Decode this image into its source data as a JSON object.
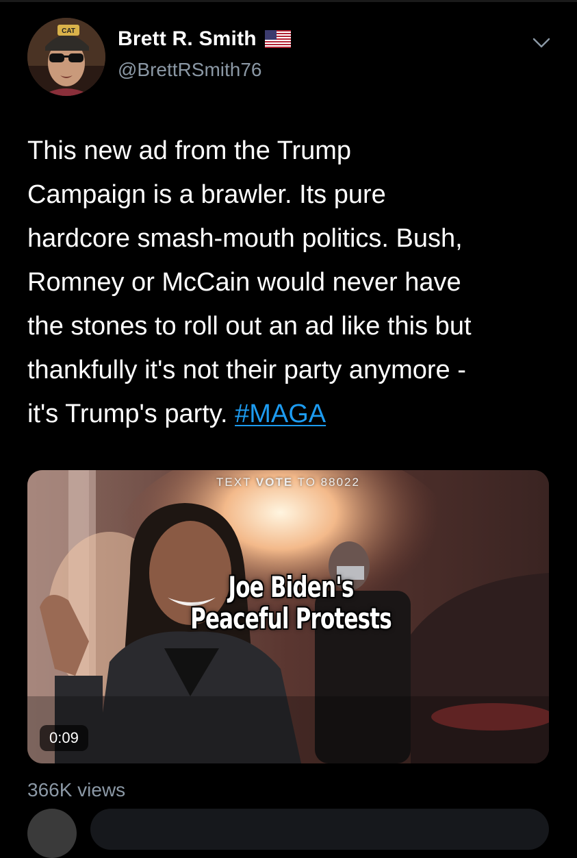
{
  "author": {
    "name": "Brett R. Smith",
    "handle": "@BrettRSmith76",
    "flag": "us-flag-icon",
    "avatar_cap_text": "CAT"
  },
  "tweet": {
    "text_part1": "This new ad from the Trump\nCampaign is a brawler. Its pure\nhardcore smash-mouth politics. Bush,\nRomney or McCain would never have\nthe stones to roll out an ad like this but\nthankfully it's not their party anymore -\nit's Trump's party. ",
    "hashtag": "#MAGA"
  },
  "media": {
    "top_text_pre": "TEXT ",
    "top_text_bold": "VOTE",
    "top_text_post": " TO 88022",
    "headline_line1": "Joe Biden's",
    "headline_line2": "Peaceful Protests",
    "duration": "0:09"
  },
  "stats": {
    "views": "366K views"
  },
  "colors": {
    "background": "#000000",
    "secondary_text": "#8b98a5",
    "link": "#1d9bf0"
  }
}
